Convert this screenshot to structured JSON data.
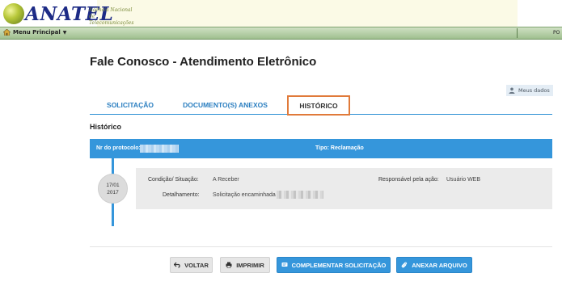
{
  "header": {
    "brand": "ANATEL",
    "subtitle_line1": "Agência Nacional",
    "subtitle_line2": "de Telecomunicações"
  },
  "menubar": {
    "main_label": "Menu Principal",
    "right_text": "PO"
  },
  "page": {
    "title": "Fale Conosco - Atendimento Eletrônico",
    "meus_dados": "Meus dados",
    "section_title": "Histórico"
  },
  "tabs": [
    {
      "label": "SOLICITAÇÃO"
    },
    {
      "label": "DOCUMENTO(S) ANEXOS"
    },
    {
      "label": "HISTÓRICO"
    }
  ],
  "protocol_bar": {
    "protocol_label": "Nr do protocolo:",
    "tipo": "Tipo: Reclamação"
  },
  "history_entry": {
    "date_day": "17/01",
    "date_year": "2017",
    "condicao_label": "Condição/ Situação:",
    "condicao_value": "A Receber",
    "responsavel_label": "Responsável pela ação:",
    "responsavel_value": "Usuário WEB",
    "detalhamento_label": "Detalhamento:",
    "detalhamento_value": "Solicitação encaminhada à"
  },
  "buttons": {
    "voltar": "VOLTAR",
    "imprimir": "IMPRIMIR",
    "complementar": "COMPLEMENTAR SOLICITAÇÃO",
    "anexar": "ANEXAR ARQUIVO"
  },
  "colors": {
    "accent": "#3596db",
    "active_tab_border": "#e07a3a",
    "menubar": "#9fbf8f"
  },
  "icons": [
    "home-icon",
    "chevron-down-icon",
    "user-icon",
    "arrow-back-icon",
    "printer-icon",
    "message-icon",
    "attach-icon"
  ]
}
